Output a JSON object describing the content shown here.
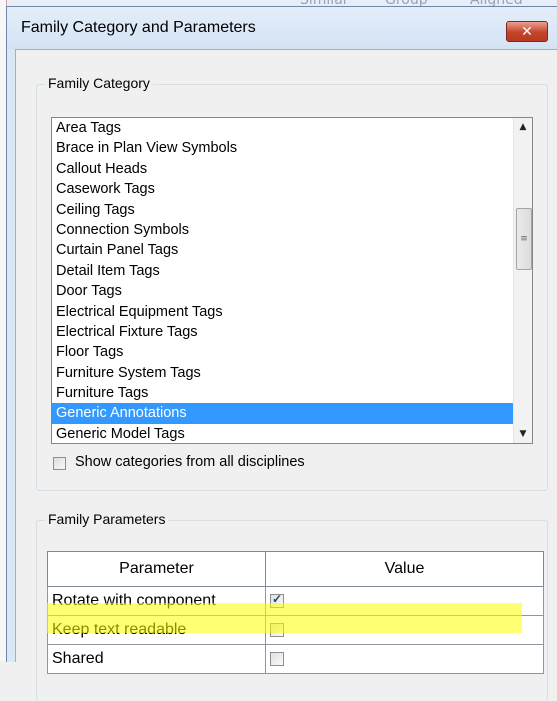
{
  "background": {
    "fragments": [
      "Similar",
      "Group",
      "Aligned"
    ]
  },
  "dialog": {
    "title": "Family Category and Parameters",
    "close_label": "✕"
  },
  "family_category": {
    "group_label": "Family Category",
    "items": [
      "Area Tags",
      "Brace in Plan View Symbols",
      "Callout Heads",
      "Casework Tags",
      "Ceiling Tags",
      "Connection Symbols",
      "Curtain Panel Tags",
      "Detail Item Tags",
      "Door Tags",
      "Electrical Equipment Tags",
      "Electrical Fixture Tags",
      "Floor Tags",
      "Furniture System Tags",
      "Furniture Tags",
      "Generic Annotations",
      "Generic Model Tags"
    ],
    "selected": "Generic Annotations",
    "show_all_label": "Show categories from all disciplines",
    "show_all_checked": false
  },
  "family_parameters": {
    "group_label": "Family Parameters",
    "headers": {
      "parameter": "Parameter",
      "value": "Value"
    },
    "rows": [
      {
        "name": "Rotate with component",
        "checked": true
      },
      {
        "name": "Keep text readable",
        "checked": false,
        "highlighted": true
      },
      {
        "name": "Shared",
        "checked": false
      }
    ]
  },
  "colors": {
    "selection": "#3399ff",
    "highlight": "#ffff00",
    "close_button": "#c6432c"
  }
}
